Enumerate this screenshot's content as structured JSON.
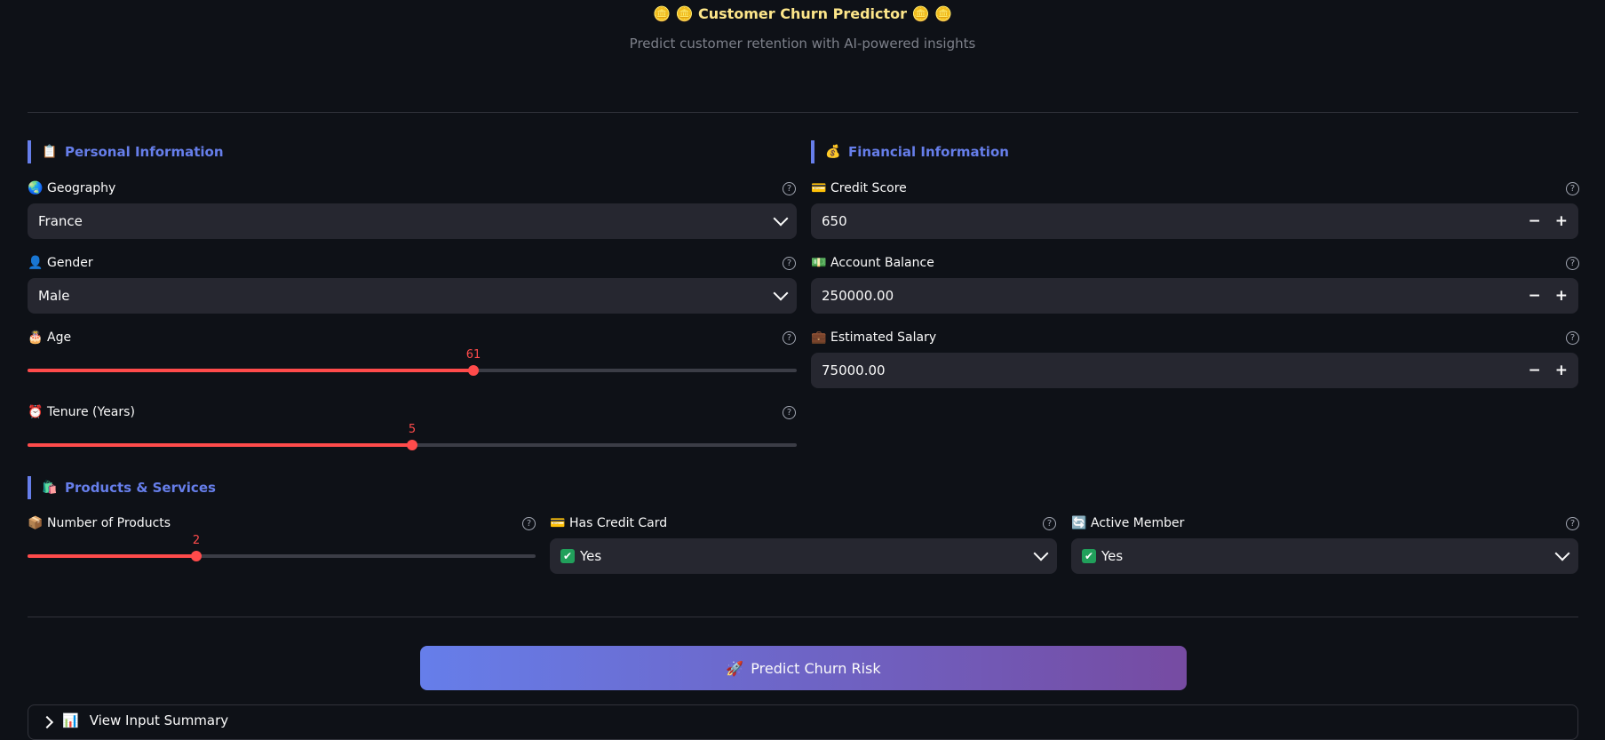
{
  "header": {
    "title": "🪙 🪙 Customer Churn Predictor 🪙 🪙",
    "subtitle": "Predict customer retention with AI-powered insights"
  },
  "sections": {
    "personal": {
      "icon": "📋",
      "label": "Personal Information"
    },
    "financial": {
      "icon": "💰",
      "label": "Financial Information"
    },
    "products": {
      "icon": "🛍️",
      "label": "Products & Services"
    }
  },
  "fields": {
    "geography": {
      "icon": "🌏",
      "label": "Geography",
      "value": "France"
    },
    "gender": {
      "icon": "👤",
      "label": "Gender",
      "value": "Male"
    },
    "age": {
      "icon": "🎂",
      "label": "Age",
      "value": "61",
      "fraction": 0.58
    },
    "tenure": {
      "icon": "⏰",
      "label": "Tenure (Years)",
      "value": "5",
      "fraction": 0.5
    },
    "credit_score": {
      "icon": "💳",
      "label": "Credit Score",
      "value": "650"
    },
    "balance": {
      "icon": "💵",
      "label": "Account Balance",
      "value": "250000.00"
    },
    "salary": {
      "icon": "💼",
      "label": "Estimated Salary",
      "value": "75000.00"
    },
    "num_products": {
      "icon": "📦",
      "label": "Number of Products",
      "value": "2",
      "fraction": 0.333
    },
    "has_card": {
      "icon": "💳",
      "label": "Has Credit Card",
      "value": "Yes"
    },
    "active": {
      "icon": "🔄",
      "label": "Active Member",
      "value": "Yes"
    }
  },
  "stepper": {
    "minus": "−",
    "plus": "+"
  },
  "help_glyph": "?",
  "predict_button": {
    "icon": "🚀",
    "label": "Predict Churn Risk"
  },
  "expander": {
    "icon": "📊",
    "label": "View Input Summary"
  },
  "colors": {
    "accent": "#667eea",
    "slider": "#ff4b4b",
    "gradient_end": "#764ba2"
  }
}
